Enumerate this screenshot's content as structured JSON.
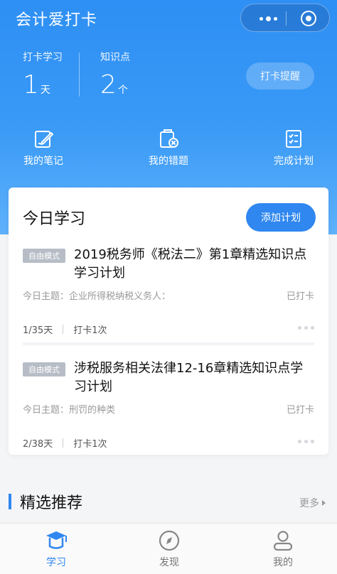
{
  "app": {
    "title": "会计爱打卡"
  },
  "stats": {
    "days_label": "打卡学习",
    "days_value": "1",
    "days_unit": "天",
    "points_label": "知识点",
    "points_value": "2",
    "points_unit": "个",
    "remind_label": "打卡提醒"
  },
  "quick_actions": [
    {
      "label": "我的笔记",
      "icon": "notes-icon"
    },
    {
      "label": "我的错题",
      "icon": "wrong-questions-icon"
    },
    {
      "label": "完成计划",
      "icon": "checklist-icon"
    }
  ],
  "today": {
    "title": "今日学习",
    "add_label": "添加计划",
    "plans": [
      {
        "mode": "自由模式",
        "title": "2019税务师《税法二》第1章精选知识点学习计划",
        "topic": "今日主题：企业所得税纳税义务人：",
        "status": "已打卡",
        "progress": "1/35天",
        "checkins": "打卡1次"
      },
      {
        "mode": "自由模式",
        "title": "涉税服务相关法律12-16章精选知识点学习计划",
        "topic": "今日主题：刑罚的种类",
        "status": "已打卡",
        "progress": "2/38天",
        "checkins": "打卡1次"
      }
    ]
  },
  "featured": {
    "title": "精选推荐",
    "more_label": "更多"
  },
  "tabbar": [
    {
      "label": "学习",
      "icon": "graduation-cap-icon",
      "active": true
    },
    {
      "label": "发现",
      "icon": "compass-icon",
      "active": false
    },
    {
      "label": "我的",
      "icon": "user-icon",
      "active": false
    }
  ],
  "colors": {
    "primary": "#2f87ef",
    "hero_top": "#2e8ff4",
    "muted": "#999999",
    "tag_bg": "#b7bdc6"
  }
}
